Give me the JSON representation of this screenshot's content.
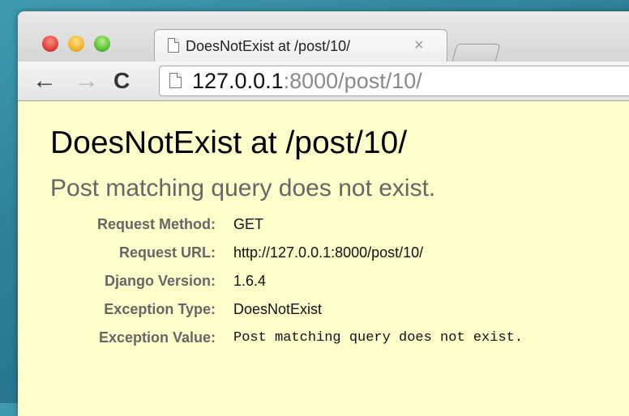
{
  "browser": {
    "tab": {
      "title": "DoesNotExist at /post/10/",
      "close_glyph": "×"
    },
    "toolbar": {
      "back_glyph": "←",
      "forward_glyph": "→",
      "reload_glyph": "C",
      "url_host": "127.0.0.1",
      "url_rest": ":8000/post/10/"
    }
  },
  "page": {
    "title": "DoesNotExist at /post/10/",
    "subtitle": "Post matching query does not exist.",
    "meta": [
      {
        "key": "Request Method:",
        "value": "GET"
      },
      {
        "key": "Request URL:",
        "value": "http://127.0.0.1:8000/post/10/"
      },
      {
        "key": "Django Version:",
        "value": "1.6.4"
      },
      {
        "key": "Exception Type:",
        "value": "DoesNotExist"
      },
      {
        "key": "Exception Value:",
        "value": "Post matching query does not exist."
      }
    ],
    "colors": {
      "background": "#ffffcc",
      "label": "#666666",
      "subtitle": "#666666"
    }
  }
}
